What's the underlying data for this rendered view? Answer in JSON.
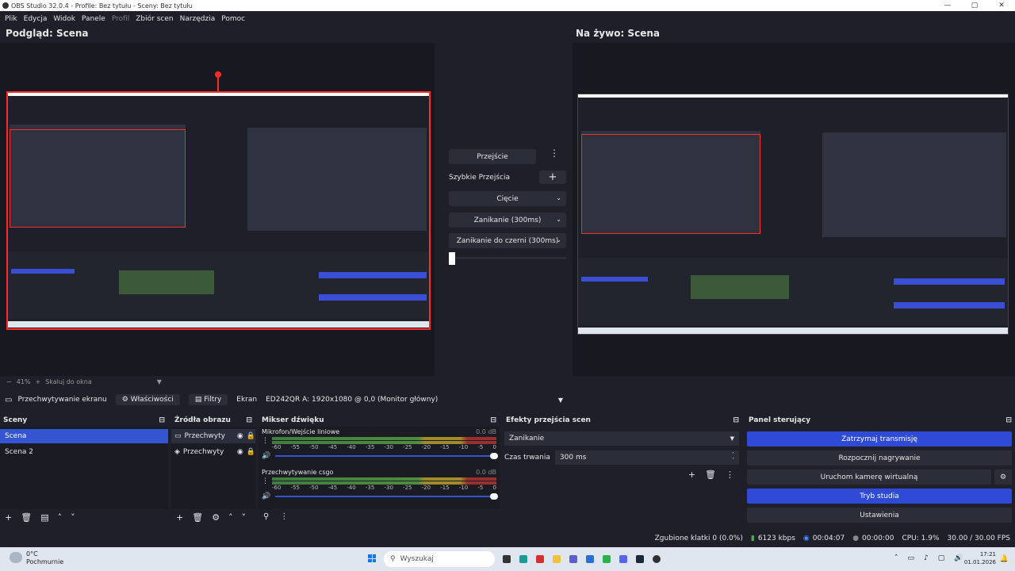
{
  "window": {
    "title": "OBS Studio 32.0.4 - Profile: Bez tytułu - Sceny: Bez tytułu"
  },
  "menu": [
    "Plik",
    "Edycja",
    "Widok",
    "Panele",
    "Profil",
    "Zbiór scen",
    "Narzędzia",
    "Pomoc"
  ],
  "preview": {
    "label": "Podgląd: Scena",
    "zoom": "41%",
    "scale_mode": "Skaluj do okna"
  },
  "live": {
    "label": "Na żywo: Scena"
  },
  "transitions": {
    "transition_button": "Przejście",
    "quick_label": "Szybkie Przejścia",
    "items": [
      "Cięcie",
      "Zanikanie (300ms)",
      "Zanikanie do czerni (300ms)"
    ]
  },
  "source_toolbar": {
    "source_name": "Przechwytywanie ekranu",
    "properties": "Właściwości",
    "filters": "Filtry",
    "screen_label": "Ekran",
    "screen_value": "ED242QR A: 1920x1080 @ 0,0 (Monitor główny)"
  },
  "scenes": {
    "title": "Sceny",
    "items": [
      "Scena",
      "Scena 2"
    ]
  },
  "sources": {
    "title": "Źródła obrazu",
    "items": [
      "Przechwyty",
      "Przechwyty"
    ]
  },
  "mixer": {
    "title": "Mikser dźwięku",
    "channels": [
      {
        "name": "Mikrofon/Wejście liniowe",
        "db": "0.0 dB"
      },
      {
        "name": "Przechwytywanie csgo",
        "db": "0.0 dB"
      }
    ],
    "ticks": [
      "-60",
      "-55",
      "-50",
      "-45",
      "-40",
      "-35",
      "-30",
      "-25",
      "-20",
      "-15",
      "-10",
      "-5",
      "0"
    ]
  },
  "transition_effects": {
    "title": "Efekty przejścia scen",
    "selected": "Zanikanie",
    "duration_label": "Czas trwania",
    "duration_value": "300 ms"
  },
  "controls": {
    "title": "Panel sterujący",
    "stop_stream": "Zatrzymaj transmisję",
    "start_recording": "Rozpocznij nagrywanie",
    "virtual_camera": "Uruchom kamerę wirtualną",
    "studio_mode": "Tryb studia",
    "settings": "Ustawienia"
  },
  "status": {
    "dropped": "Zgubione klatki 0 (0.0%)",
    "bitrate": "6123 kbps",
    "stream_time": "00:04:07",
    "rec_time": "00:00:00",
    "cpu": "CPU: 1.9%",
    "fps": "30.00 / 30.00 FPS"
  },
  "taskbar": {
    "weather_temp": "0°C",
    "weather_desc": "Pochmurnie",
    "search_placeholder": "Wyszukaj",
    "time": "17:21",
    "date": "01.01.2026"
  },
  "colors": {
    "accent": "#2f4ad6",
    "bg": "#1e1f29",
    "selection_red": "#ff2a2a"
  }
}
